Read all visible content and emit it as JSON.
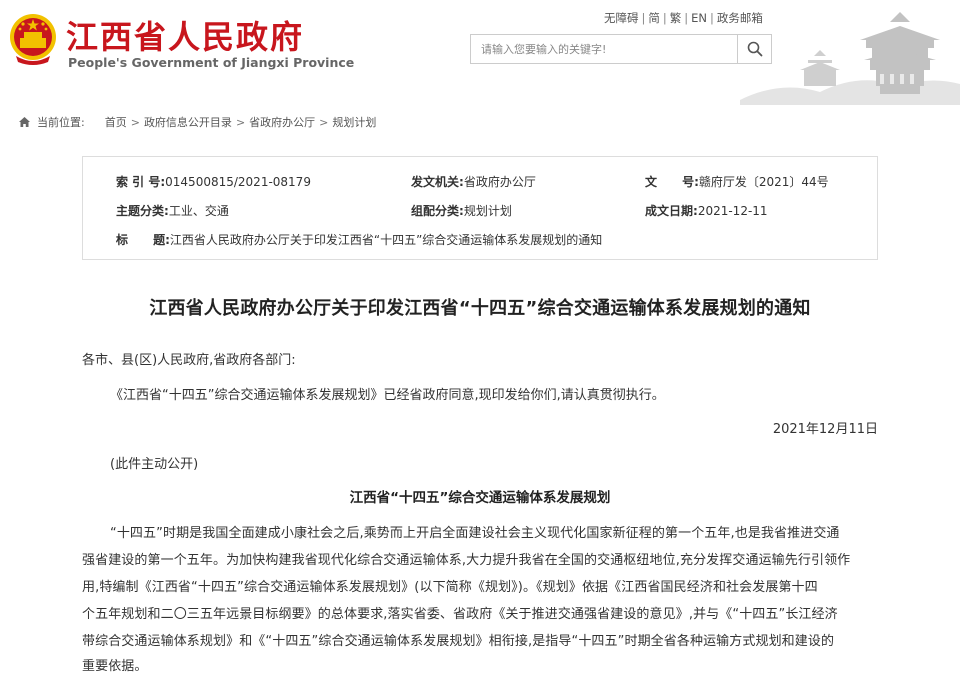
{
  "header": {
    "site_title": "江西省人民政府",
    "site_subtitle": "People's Government of Jiangxi Province",
    "links": [
      "无障碍",
      "简",
      "繁",
      "EN",
      "政务邮箱"
    ],
    "search": {
      "placeholder": "请输入您要输入的关键字!"
    },
    "colors": {
      "brand_red": "#c8161d",
      "emblem_gold": "#f2c200"
    }
  },
  "breadcrumb": {
    "label": "当前位置:",
    "items": [
      "首页",
      "政府信息公开目录",
      "省政府办公厅",
      "规划计划"
    ],
    "separator": ">"
  },
  "info": {
    "index_no": {
      "key": "索 引 号:",
      "value": "014500815/2021-08179"
    },
    "issuer": {
      "key": "发文机关:",
      "value": "省政府办公厅"
    },
    "doc_no": {
      "key": "文      号:",
      "value": "赣府厅发〔2021〕44号"
    },
    "topic": {
      "key": "主题分类:",
      "value": "工业、交通"
    },
    "category": {
      "key": "组配分类:",
      "value": "规划计划"
    },
    "date": {
      "key": "成文日期:",
      "value": "2021-12-11"
    },
    "title": {
      "key": "标      题:",
      "value": "江西省人民政府办公厅关于印发江西省“十四五”综合交通运输体系发展规划的通知"
    }
  },
  "article": {
    "title": "江西省人民政府办公厅关于印发江西省“十四五”综合交通运输体系发展规划的通知",
    "salutation": "各市、县(区)人民政府,省政府各部门:",
    "notice": "《江西省“十四五”综合交通运输体系发展规划》已经省政府同意,现印发给你们,请认真贯彻执行。",
    "date": "2021年12月11日",
    "disclosure": "(此件主动公开)",
    "sub_title": "江西省“十四五”综合交通运输体系发展规划",
    "body_lines": [
      "“十四五”时期是我国全面建成小康社会之后,乘势而上开启全面建设社会主义现代化国家新征程的第一个五年,也是我省推进交通",
      "强省建设的第一个五年。为加快构建我省现代化综合交通运输体系,大力提升我省在全国的交通枢纽地位,充分发挥交通运输先行引领作",
      "用,特编制《江西省“十四五”综合交通运输体系发展规划》(以下简称《规划》)。《规划》依据《江西省国民经济和社会发展第十四",
      "个五年规划和二〇三五年远景目标纲要》的总体要求,落实省委、省政府《关于推进交通强省建设的意见》,并与《“十四五”长江经济",
      "带综合交通运输体系规划》和《“十四五”综合交通运输体系发展规划》相衔接,是指导“十四五”时期全省各种运输方式规划和建设的",
      "重要依据。"
    ]
  }
}
